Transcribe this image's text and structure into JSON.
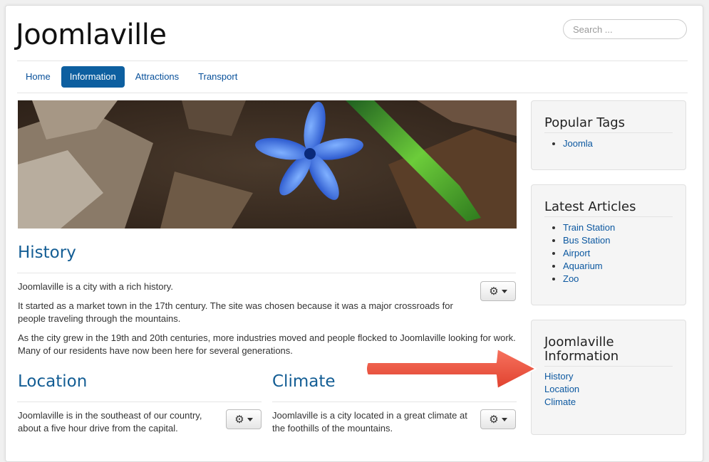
{
  "site": {
    "title": "Joomlaville"
  },
  "search": {
    "placeholder": "Search ..."
  },
  "nav": {
    "items": [
      "Home",
      "Information",
      "Attractions",
      "Transport"
    ],
    "active": 1
  },
  "articles": {
    "history": {
      "title": "History",
      "paragraphs": [
        "Joomlaville is a city with a rich history.",
        "It started as a market town in the 17th century. The site was chosen because it was a major crossroads for people traveling through the mountains.",
        "As the city grew in the 19th and 20th centuries, more industries moved and people flocked to Joomlaville looking for work. Many of our residents have now been here for several generations."
      ]
    },
    "location": {
      "title": "Location",
      "text": "Joomlaville is in the southeast of our country, about a five hour drive from the capital."
    },
    "climate": {
      "title": "Climate",
      "text": "Joomlaville is a city located in a great climate at the foothills of the mountains."
    }
  },
  "sidebar": {
    "popular_tags": {
      "title": "Popular Tags",
      "items": [
        "Joomla"
      ]
    },
    "latest_articles": {
      "title": "Latest Articles",
      "items": [
        "Train Station",
        "Bus Station",
        "Airport",
        "Aquarium",
        "Zoo"
      ]
    },
    "info": {
      "title": "Joomlaville Information",
      "items": [
        "History",
        "Location",
        "Climate"
      ]
    }
  },
  "colors": {
    "brand_blue": "#0d5fa0",
    "link": "#0c58a0",
    "heading": "#135d94",
    "arrow": "#f05a45"
  },
  "icons": {
    "gear": "gear-icon",
    "caret": "chevron-down-icon",
    "arrow": "right-arrow-annotation"
  }
}
